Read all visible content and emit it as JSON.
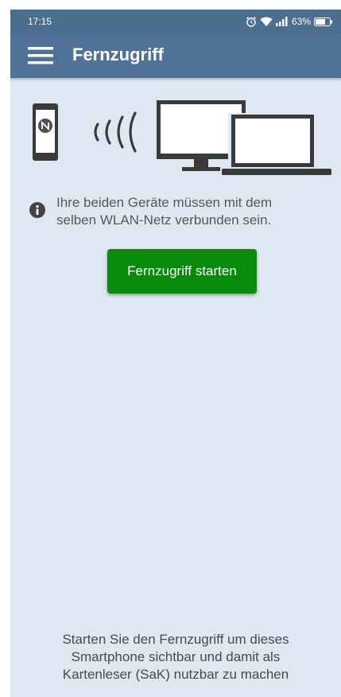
{
  "status_bar": {
    "time": "17:15",
    "battery_percent": "63%",
    "icons": [
      "alarm-icon",
      "wifi-icon",
      "signal-icon",
      "battery-icon"
    ]
  },
  "app_bar": {
    "title": "Fernzugriff",
    "menu_icon": "hamburger-menu-icon",
    "color": "#4f7296"
  },
  "illustration": {
    "icons": [
      "smartphone-nfc-icon",
      "wireless-waves-icon",
      "monitor-icon",
      "laptop-icon"
    ]
  },
  "info": {
    "icon": "info-icon",
    "line1": "Ihre beiden Geräte müssen mit dem",
    "line2": "selben WLAN-Netz verbunden sein."
  },
  "primary_button": {
    "label": "Fernzugriff starten",
    "color": "#0a8a0a"
  },
  "footer": {
    "line1": "Starten Sie den Fernzugriff um dieses",
    "line2": "Smartphone sichtbar und damit als",
    "line3": "Kartenleser (SaK) nutzbar zu machen"
  },
  "colors": {
    "background": "#dde8f3",
    "status_bar": "#4c6e8f"
  }
}
